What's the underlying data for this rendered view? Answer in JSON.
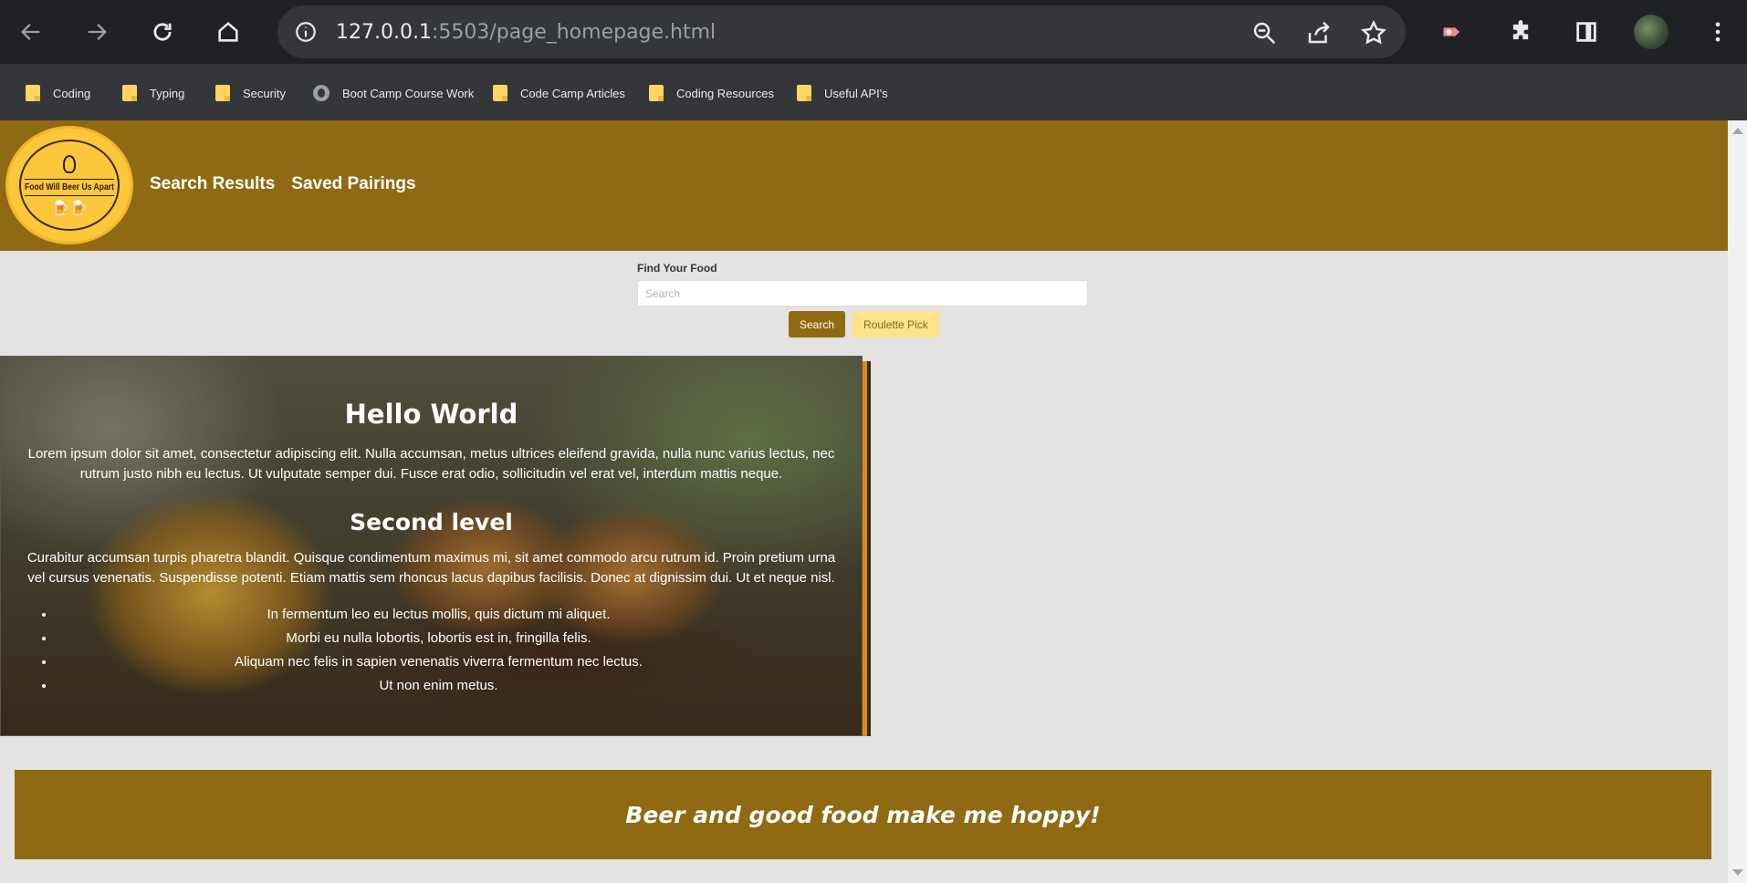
{
  "browser": {
    "url_host": "127.0.0.1",
    "url_port": ":5503",
    "url_path": "/page_homepage.html",
    "bookmarks": [
      {
        "label": "Coding",
        "icon": "folder-icon"
      },
      {
        "label": "Typing",
        "icon": "folder-icon"
      },
      {
        "label": "Security",
        "icon": "folder-icon"
      },
      {
        "label": "Boot Camp Course Work",
        "icon": "globe-icon"
      },
      {
        "label": "Code Camp Articles",
        "icon": "folder-icon"
      },
      {
        "label": "Coding Resources",
        "icon": "folder-icon"
      },
      {
        "label": "Useful API's",
        "icon": "folder-icon"
      }
    ]
  },
  "header": {
    "logo_text": "Food Will Beer Us Apart",
    "nav": [
      "Search Results",
      "Saved Pairings"
    ]
  },
  "search": {
    "label": "Find Your Food",
    "placeholder": "Search",
    "search_button": "Search",
    "roulette_button": "Roulette Pick"
  },
  "hero": {
    "title": "Hello World",
    "paragraph1": "Lorem ipsum dolor sit amet, consectetur adipiscing elit. Nulla accumsan, metus ultrices eleifend gravida, nulla nunc varius lectus, nec rutrum justo nibh eu lectus. Ut vulputate semper dui. Fusce erat odio, sollicitudin vel erat vel, interdum mattis neque.",
    "subtitle": "Second level",
    "paragraph2": "Curabitur accumsan turpis pharetra blandit. Quisque condimentum maximus mi, sit amet commodo arcu rutrum id. Proin pretium urna vel cursus venenatis. Suspendisse potenti. Etiam mattis sem rhoncus lacus dapibus facilisis. Donec at dignissim dui. Ut et neque nisl.",
    "list": [
      "In fermentum leo eu lectus mollis, quis dictum mi aliquet.",
      "Morbi eu nulla lobortis, lobortis est in, fringilla felis.",
      "Aliquam nec felis in sapien venenatis viverra fermentum nec lectus.",
      "Ut non enim metus."
    ]
  },
  "footer": {
    "tagline": "Beer and good food make me hoppy!"
  },
  "colors": {
    "brand": "#8f6a12",
    "logo_yellow": "#fcc73a",
    "roulette_bg": "#fde38a",
    "page_bg": "#e5e3e1"
  }
}
